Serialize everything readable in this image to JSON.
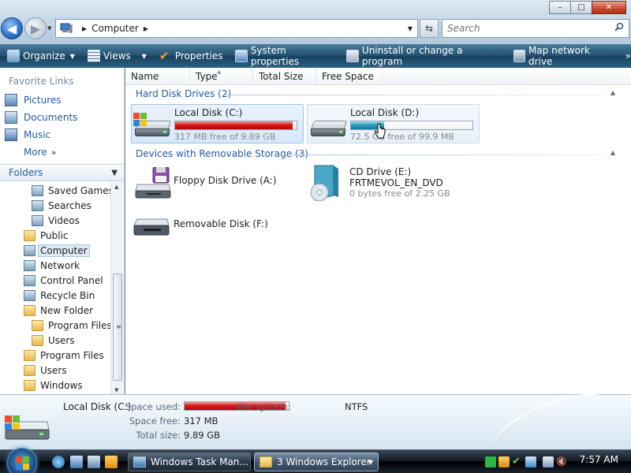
{
  "window": {
    "minimize": "–",
    "maximize": "□",
    "close": "✕"
  },
  "address": {
    "crumb": "Computer",
    "search_placeholder": "Search"
  },
  "toolbar": {
    "organize": "Organize",
    "views": "Views",
    "properties": "Properties",
    "system_properties": "System properties",
    "uninstall": "Uninstall or change a program",
    "map_drive": "Map network drive",
    "more": "»"
  },
  "sidebar": {
    "favorites_title": "Favorite Links",
    "favorites": [
      {
        "label": "Pictures",
        "icon": "pictures-icon"
      },
      {
        "label": "Documents",
        "icon": "documents-icon"
      },
      {
        "label": "Music",
        "icon": "music-icon"
      }
    ],
    "more": "More",
    "more_chevrons": "»",
    "folders_title": "Folders",
    "tree": [
      {
        "label": "Saved Games",
        "indent": 2,
        "icon": "saved-games-icon"
      },
      {
        "label": "Searches",
        "indent": 2,
        "icon": "searches-icon"
      },
      {
        "label": "Videos",
        "indent": 2,
        "icon": "videos-icon"
      },
      {
        "label": "Public",
        "indent": 1,
        "icon": "folder-icon"
      },
      {
        "label": "Computer",
        "indent": 1,
        "icon": "computer-icon",
        "selected": true
      },
      {
        "label": "Network",
        "indent": 1,
        "icon": "network-icon"
      },
      {
        "label": "Control Panel",
        "indent": 1,
        "icon": "control-panel-icon"
      },
      {
        "label": "Recycle Bin",
        "indent": 1,
        "icon": "recycle-bin-icon"
      },
      {
        "label": "New Folder",
        "indent": 1,
        "icon": "folder-icon"
      },
      {
        "label": "Program Files",
        "indent": 2,
        "icon": "folder-icon"
      },
      {
        "label": "Users",
        "indent": 2,
        "icon": "folder-icon"
      },
      {
        "label": "Program Files",
        "indent": 1,
        "icon": "folder-icon"
      },
      {
        "label": "Users",
        "indent": 1,
        "icon": "folder-icon"
      },
      {
        "label": "Windows",
        "indent": 1,
        "icon": "folder-icon"
      }
    ]
  },
  "columns": [
    "Name",
    "Type",
    "Total Size",
    "Free Space"
  ],
  "groups": {
    "hard_disks": "Hard Disk Drives (2)",
    "removable": "Devices with Removable Storage (3)"
  },
  "hard_disks": [
    {
      "name": "Local Disk (C:)",
      "free_text": "317 MB free of 9.89 GB",
      "used_fraction": 0.968,
      "bar_color": "#d81818",
      "state": "selected"
    },
    {
      "name": "Local Disk (D:)",
      "free_text": "72.5 GB free of 99.9 MB",
      "used_fraction": 0.27,
      "bar_color": "#2d9cc0",
      "state": "hover"
    }
  ],
  "removable": [
    {
      "name": "Floppy Disk Drive (A:)",
      "icon": "floppy-drive-icon"
    },
    {
      "name": "CD Drive (E:)",
      "label": "FRTMEVOL_EN_DVD",
      "free_text": "0 bytes free of 2.25 GB",
      "icon": "dvd-drive-icon"
    },
    {
      "name": "Removable Disk (F:)",
      "icon": "removable-disk-icon"
    }
  ],
  "details": {
    "name": "Local Disk (C:)",
    "space_used_label": "Space used:",
    "space_used_fraction": 0.968,
    "file_system_label": "File system:",
    "file_system": "NTFS",
    "space_free_label": "Space free:",
    "space_free": "317 MB",
    "total_size_label": "Total size:",
    "total_size": "9.89 GB"
  },
  "taskbar": {
    "tasks": [
      {
        "label": "Windows Task Man...",
        "icon": "task-manager-icon"
      },
      {
        "label": "3 Windows Explorer",
        "icon": "explorer-folder-icon",
        "active": true
      }
    ],
    "clock": "7:57 AM"
  },
  "colors": {
    "link_blue": "#1f5ba6",
    "used_red": "#d81818",
    "used_teal": "#2d9cc0"
  }
}
